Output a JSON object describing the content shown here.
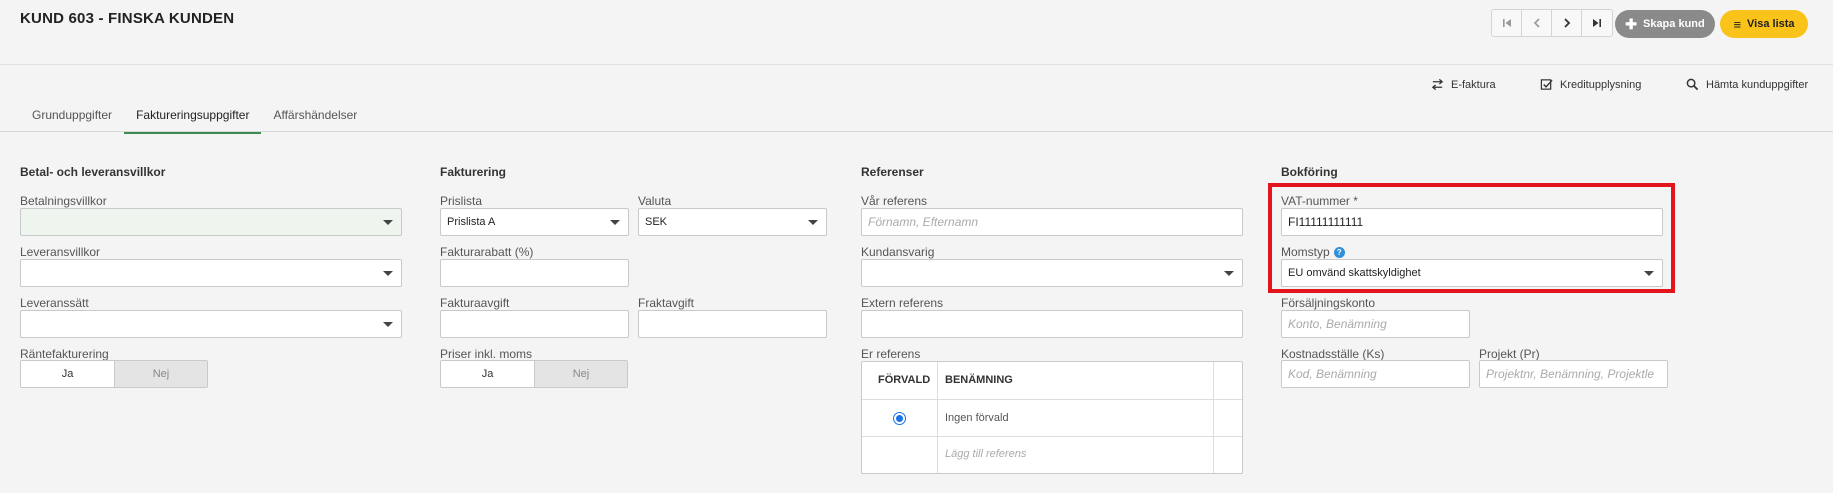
{
  "header": {
    "title": "KUND 603 - FINSKA KUNDEN",
    "create_label": "Skapa kund",
    "list_label": "Visa lista"
  },
  "actions": {
    "efaktura": "E-faktura",
    "kredit": "Kreditupplysning",
    "hamta": "Hämta kunduppgifter"
  },
  "tabs": [
    {
      "label": "Grunduppgifter"
    },
    {
      "label": "Faktureringsuppgifter"
    },
    {
      "label": "Affärshändelser"
    }
  ],
  "betal": {
    "title": "Betal- och leveransvillkor",
    "betalningsvillkor_label": "Betalningsvillkor",
    "leveransvillkor_label": "Leveransvillkor",
    "leveranssatt_label": "Leveranssätt",
    "rantefakturering_label": "Räntefakturering",
    "ja": "Ja",
    "nej": "Nej"
  },
  "fakturering": {
    "title": "Fakturering",
    "prislista_label": "Prislista",
    "prislista_value": "Prislista A",
    "valuta_label": "Valuta",
    "valuta_value": "SEK",
    "fakturarabatt_label": "Fakturarabatt (%)",
    "fakturaavgift_label": "Fakturaavgift",
    "fraktavgift_label": "Fraktavgift",
    "priser_label": "Priser inkl. moms",
    "ja": "Ja",
    "nej": "Nej"
  },
  "referenser": {
    "title": "Referenser",
    "var_referens_label": "Vår referens",
    "var_referens_placeholder": "Förnamn, Efternamn",
    "kundansvarig_label": "Kundansvarig",
    "extern_label": "Extern referens",
    "er_referens_label": "Er referens",
    "col_forvald": "FÖRVALD",
    "col_benamning": "BENÄMNING",
    "row1": "Ingen förvald",
    "add_placeholder": "Lägg till referens"
  },
  "bokforing": {
    "title": "Bokföring",
    "vat_label": "VAT-nummer *",
    "vat_value": "FI11111111111",
    "momstyp_label": "Momstyp",
    "momstyp_value": "EU omvänd skattskyldighet",
    "forsaljningskonto_label": "Försäljningskonto",
    "forsaljningskonto_placeholder": "Konto, Benämning",
    "kostnadsstalle_label": "Kostnadsställe (Ks)",
    "kostnadsstalle_placeholder": "Kod, Benämning",
    "projekt_label": "Projekt (Pr)",
    "projekt_placeholder": "Projektnr, Benämning, Projektle"
  },
  "colors": {
    "accent": "#f9c31a",
    "active_tab": "#3b8a4e",
    "highlight": "#e2141c"
  }
}
